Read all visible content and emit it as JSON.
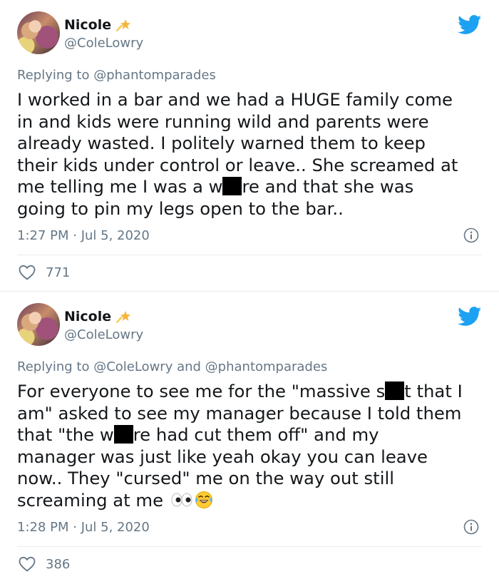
{
  "tweets": [
    {
      "name": "Nicole",
      "handle": "@ColeLowry",
      "reply_prefix": "Replying to ",
      "reply_mentions": "@phantomparades",
      "text_lines": [
        "I worked in a bar and we had a HUGE family come",
        "in and kids were running wild and parents were",
        "already wasted. I politely warned them to keep",
        "their kids under control or leave.. She screamed at"
      ],
      "text_line5_a": "me telling me I was a w",
      "text_line5_b": "re and that she was",
      "text_line6": "going to pin my legs open to the bar..",
      "timestamp": "1:27 PM · Jul 5, 2020",
      "likes": "771"
    },
    {
      "name": "Nicole",
      "handle": "@ColeLowry",
      "reply_prefix": "Replying to ",
      "reply_mentions": "@ColeLowry and @phantomparades",
      "line1_a": "For everyone to see me for the \"massive s",
      "line1_b": "t that I",
      "line2": "am\" asked to see my manager because I told them",
      "line3_a": "that \"the w",
      "line3_b": "re had cut them off\" and my",
      "line4": "manager was just like yeah okay you can leave",
      "line5": "now.. They \"cursed\" me on the way out still",
      "line6": "screaming at me",
      "timestamp": "1:28 PM · Jul 5, 2020",
      "likes": "386"
    }
  ],
  "colors": {
    "text": "#14171a",
    "secondary": "#657786",
    "twitter_blue": "#1da1f2",
    "divider": "#e6ecf0"
  },
  "icons": [
    "twitter-bird-icon",
    "shooting-star-icon",
    "info-icon",
    "heart-icon",
    "eyes-emoji-icon",
    "crying-laughing-emoji-icon"
  ]
}
